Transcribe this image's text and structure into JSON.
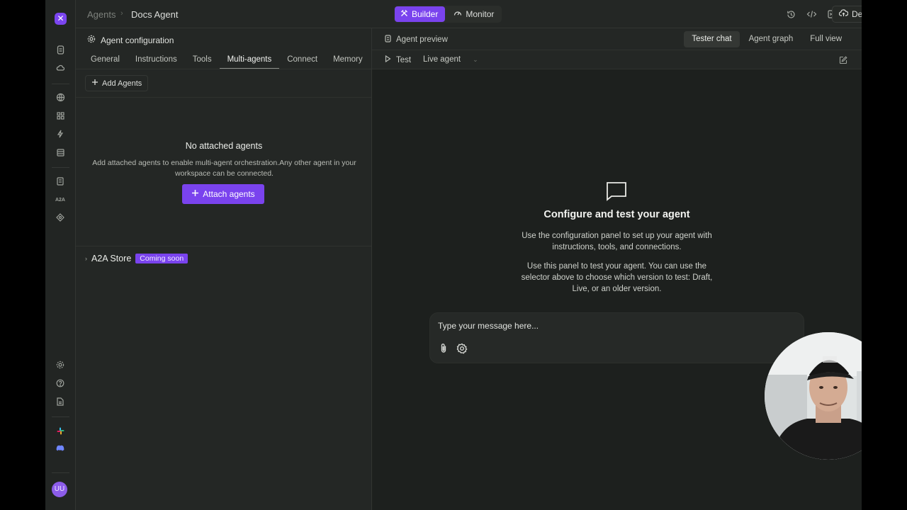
{
  "breadcrumb": {
    "root": "Agents",
    "current": "Docs Agent"
  },
  "mode_toggle": {
    "builder": "Builder",
    "monitor": "Monitor"
  },
  "actions": {
    "deploy": "Deploy"
  },
  "config": {
    "title": "Agent configuration",
    "tabs": [
      "General",
      "Instructions",
      "Tools",
      "Multi-agents",
      "Connect",
      "Memory"
    ],
    "active_tab": "Multi-agents",
    "add_agents_label": "Add Agents",
    "empty_title": "No attached agents",
    "empty_desc": "Add attached agents to enable multi-agent orchestration.Any other agent in your workspace can be connected.",
    "attach_label": "Attach agents",
    "store_label": "A2A Store",
    "store_badge": "Coming soon"
  },
  "preview": {
    "title": "Agent preview",
    "tabs": [
      "Tester chat",
      "Agent graph",
      "Full view"
    ],
    "active_tab": "Tester chat",
    "test_label": "Test",
    "version_selected": "Live agent",
    "heading": "Configure and test your agent",
    "desc1": "Use the configuration panel to set up your agent with instructions, tools, and connections.",
    "desc2": "Use this panel to test your agent. You can use the selector above to choose which version to test: Draft, Live, or an older version.",
    "input_placeholder": "Type your message here..."
  },
  "rail": {
    "a2a_label": "A2A",
    "avatar_initials": "UU"
  },
  "colors": {
    "accent": "#7a43ee",
    "background": "#242725",
    "preview_bg": "#1d201e"
  }
}
